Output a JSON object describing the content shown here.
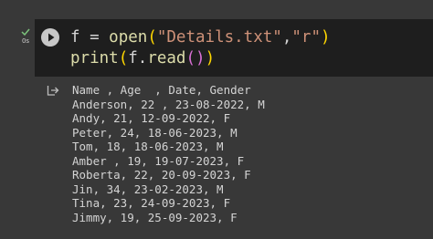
{
  "cell": {
    "exec_time": "0s",
    "code_lines": [
      [
        {
          "t": "f = ",
          "c": ""
        },
        {
          "t": "open",
          "c": "tok-fn"
        },
        {
          "t": "(",
          "c": "tok-p1"
        },
        {
          "t": "\"Details.txt\"",
          "c": "tok-str"
        },
        {
          "t": ",",
          "c": ""
        },
        {
          "t": "\"r\"",
          "c": "tok-str"
        },
        {
          "t": ")",
          "c": "tok-p1"
        }
      ],
      [
        {
          "t": "print",
          "c": "tok-fn"
        },
        {
          "t": "(",
          "c": "tok-p1"
        },
        {
          "t": "f.",
          "c": ""
        },
        {
          "t": "read",
          "c": "tok-fn"
        },
        {
          "t": "(",
          "c": "tok-p2"
        },
        {
          "t": ")",
          "c": "tok-p2"
        },
        {
          "t": ")",
          "c": "tok-p1"
        }
      ]
    ]
  },
  "output": {
    "lines": [
      "Name , Age  , Date, Gender",
      "Anderson, 22 , 23-08-2022, M",
      "Andy, 21, 12-09-2022, F",
      "Peter, 24, 18-06-2023, M",
      "Tom, 18, 18-06-2023, M",
      "Amber , 19, 19-07-2023, F",
      "Roberta, 22, 20-09-2023, F",
      "Jin, 34, 23-02-2023, M",
      "Tina, 23, 24-09-2023, F",
      "Jimmy, 19, 25-09-2023, F"
    ]
  },
  "icons": {
    "run": "play-circle-icon",
    "status": "check-icon",
    "output": "output-redirect-icon"
  },
  "colors": {
    "page_background": "#383838",
    "cell_background": "#1e1e1e",
    "status_green": "#7cc27c",
    "function_yellow": "#dcdcaa",
    "string_orange": "#ce9178",
    "bracket_gold": "#ffd700",
    "bracket_purple": "#da70d6"
  }
}
